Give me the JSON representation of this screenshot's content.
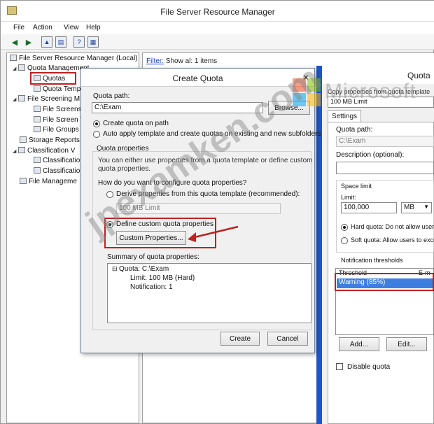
{
  "app": {
    "title": "File Server Resource Manager",
    "menu": [
      "File",
      "Action",
      "View",
      "Help"
    ]
  },
  "tree": {
    "root": "File Server Resource Manager (Local)",
    "items": [
      {
        "label": "Quota Management"
      },
      {
        "label": "Quotas"
      },
      {
        "label": "Quota Temp"
      },
      {
        "label": "File Screening M"
      },
      {
        "label": "File Screens"
      },
      {
        "label": "File Screen T"
      },
      {
        "label": "File Groups"
      },
      {
        "label": "Storage Reports"
      },
      {
        "label": "Classification V"
      },
      {
        "label": "Classificatio"
      },
      {
        "label": "Classificatio"
      },
      {
        "label": "File Manageme"
      }
    ]
  },
  "content": {
    "filter_link": "Filter:",
    "filter_text": " Show al: 1 items"
  },
  "dialog": {
    "title": "Create Quota",
    "close": "×",
    "quota_path_label": "Quota path:",
    "quota_path_value": "C:\\Exam",
    "browse": "Browse...",
    "radio_create": "Create quota on path",
    "radio_auto": "Auto apply template and create quotas on existing and new subfolders",
    "properties_header": "Quota properties",
    "properties_desc_1": "You can either use properties from a quota template or define custom",
    "properties_desc_2": "quota properties.",
    "how_configure": "How do you want to configure quota properties?",
    "radio_derive": "Derive properties from this quota template (recommended):",
    "template_value": "100 MB Limit",
    "radio_define": "Define custom quota properties",
    "custom_properties": "Custom Properties...",
    "summary_label": "Summary of quota properties:",
    "summary_lines": [
      "Quota: C:\\Exam",
      "Limit: 100 MB (Hard)",
      "Notification: 1"
    ],
    "create": "Create",
    "cancel": "Cancel"
  },
  "panel2": {
    "title": "Quota",
    "copy_text": "Copy properties from quota template",
    "template": "100 MB Limit",
    "tab_settings": "Settings",
    "quota_path_label": "Quota path:",
    "quota_path_value": "C:\\Exam",
    "description_label": "Description (optional):",
    "space_limit": "Space limit",
    "limit_label": "Limit:",
    "limit_value": "100,000",
    "limit_unit": "MB",
    "hard_quota": "Hard quota: Do not allow users",
    "soft_quota": "Soft quota: Allow users to exce",
    "notification_thresholds": "Notification thresholds",
    "col_threshold": "Threshold",
    "col_email": "E-m",
    "threshold_row": "Warning (85%)",
    "add": "Add...",
    "edit": "Edit...",
    "disable_quota": "Disable quota"
  },
  "watermark": {
    "site": "jpexamken.com",
    "brand": "Microsoft"
  }
}
